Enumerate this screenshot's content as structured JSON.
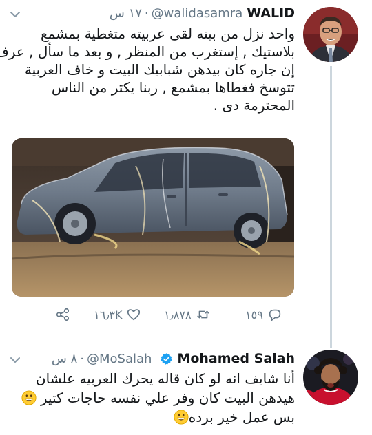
{
  "tweet1": {
    "name": "WALID",
    "handle": "@walidasamra",
    "time": "١٧ س",
    "text_lines": [
      "واحد نزل من بيته لقى عربيته متغطية بمشمع",
      "بلاستيك , إستغرب من المنظر , و بعد ما سأل , عرف",
      "إن جاره كان بيدهن شبابيك البيت و خاف العربية",
      "تتوسخ فغطاها بمشمع , ربنا يكتر من الناس",
      "المحترمة دى ."
    ],
    "actions": {
      "reply_count": "١٥٩",
      "retweet_count": "١٫٨٧٨",
      "like_count": "١٦٫٣K"
    }
  },
  "tweet2": {
    "name": "Mohamed Salah",
    "handle": "@MoSalah",
    "time": "٨ س",
    "text_lines": [
      "أنا شايف انه لو كان قاله يحرك العربيه علشان",
      "هيدهن البيت كان وفر علي نفسه حاجات كتير",
      "بس عمل خير برده"
    ]
  },
  "icons": {
    "caret": "chevron-down-icon",
    "reply": "reply-icon",
    "retweet": "retweet-icon",
    "like": "heart-icon",
    "share": "share-icon",
    "verified": "verified-badge-icon",
    "emoji": "grinning-face-emoji"
  },
  "colors": {
    "text": "#14171a",
    "secondary": "#657786",
    "verified_blue": "#1da1f2",
    "thread_line": "#ccd6dd"
  }
}
